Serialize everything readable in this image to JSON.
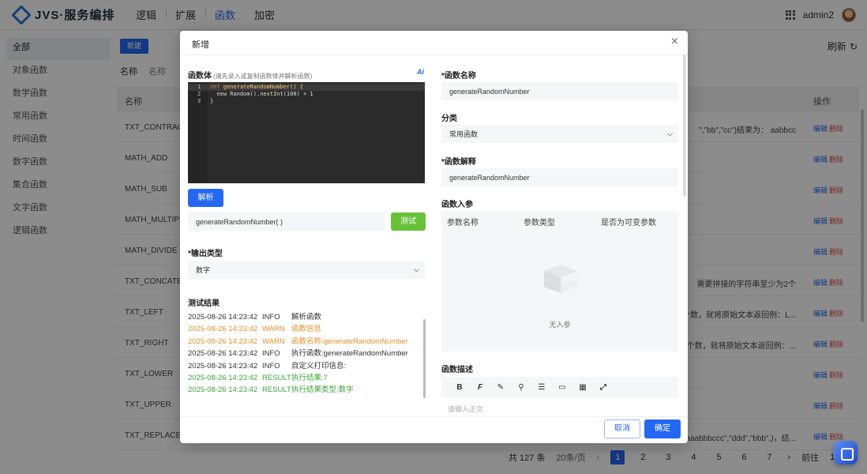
{
  "app": {
    "logo_text": "JVS·服务编排",
    "nav": [
      "逻辑",
      "扩展",
      "函数",
      "加密"
    ],
    "nav_active": "函数",
    "user": "admin2"
  },
  "sidebar": {
    "items": [
      "全部",
      "对象函数",
      "数学函数",
      "常用函数",
      "时间函数",
      "数字函数",
      "集合函数",
      "文字函数",
      "逻辑函数"
    ],
    "active": "全部"
  },
  "main": {
    "new_button": "新建",
    "refresh": "刷新",
    "filter_label": "名称",
    "filter_placeholder": "名称",
    "col_name": "名称",
    "col_action": "操作",
    "rows": [
      {
        "name": "TXT_CONTRACT",
        "desc": "\",\"bb\",\"cc\")结果为： aabbcc"
      },
      {
        "name": "MATH_ADD",
        "desc": ""
      },
      {
        "name": "MATH_SUB",
        "desc": ""
      },
      {
        "name": "MATH_MULTIPLY",
        "desc": ""
      },
      {
        "name": "MATH_DIVIDE",
        "desc": ""
      },
      {
        "name": "TXT_CONCATEN",
        "desc": "需要拼接的字符串至少为2个"
      },
      {
        "name": "TXT_LEFT",
        "desc": "符个数，就将原始文本返回例：L..."
      },
      {
        "name": "TXT_RIGHT",
        "desc": "字符个数，就将原始文本返回例：..."
      },
      {
        "name": "TXT_LOWER",
        "desc": ""
      },
      {
        "name": "TXT_UPPER",
        "desc": ""
      },
      {
        "name": "TXT_REPLACE",
        "desc": "E(\"aaabbbccc\",\"ddd\",\"bbb\",)，结..."
      }
    ],
    "edit": "编辑",
    "delete": "删除",
    "pager": {
      "total": "共 127 条",
      "size": "20条/页",
      "pages": [
        "1",
        "2",
        "3",
        "4",
        "5",
        "6",
        "7"
      ],
      "current": "1",
      "goto": "前往",
      "goto_value": "1"
    }
  },
  "modal": {
    "title": "新增",
    "close": "×",
    "body_label": "函数体",
    "body_hint": "(请先录入或复制函数体并解析函数)",
    "ai_icon": "Ai",
    "code_lines": [
      {
        "no": "1",
        "text": "def generateRandomNumber() {"
      },
      {
        "no": "2",
        "text": "  new Random().nextInt(100) + 1"
      },
      {
        "no": "3",
        "text": "}"
      }
    ],
    "parse_button": "解析",
    "signature": "generateRandomNumber( )",
    "test_button": "测试",
    "output_type_label": "*输出类型",
    "output_type_value": "数字",
    "test_result_label": "测试结果",
    "logs": [
      {
        "ts": "2025-08-26 14:23:42",
        "level": "INFO",
        "msg": "解析函数",
        "kind": "info"
      },
      {
        "ts": "2025-08-26 14:23:42",
        "level": "WARN",
        "msg": "函数信息",
        "kind": "warn"
      },
      {
        "ts": "2025-08-26 14:23:42",
        "level": "WARN",
        "msg": "函数名称:generateRandomNumber",
        "kind": "warn"
      },
      {
        "ts": "2025-08-26 14:23:42",
        "level": "INFO",
        "msg": "执行函数:generateRandomNumber",
        "kind": "info"
      },
      {
        "ts": "2025-08-26 14:23:42",
        "level": "INFO",
        "msg": "自定义打印信息:",
        "kind": "info"
      },
      {
        "ts": "2025-08-26 14:23:42",
        "level": "RESULT",
        "msg": "执行结果:7",
        "kind": "result"
      },
      {
        "ts": "2025-08-26 14:23:42",
        "level": "RESULT",
        "msg": "执行结果类型:数字",
        "kind": "result"
      }
    ],
    "name_label": "*函数名称",
    "name_value": "generateRandomNumber",
    "category_label": "分类",
    "category_value": "常用函数",
    "explain_label": "*函数解释",
    "explain_value": "generateRandomNumber",
    "params_label": "函数入参",
    "param_cols": [
      "参数名称",
      "参数类型",
      "是否为可变参数"
    ],
    "params_empty": "无入参",
    "desc_label": "函数描述",
    "desc_placeholder": "请输入正文",
    "toolbar_icons": [
      "bold-icon",
      "font-icon",
      "brush-icon",
      "link-icon",
      "list-icon",
      "image-icon",
      "table-icon",
      "fullscreen-icon"
    ],
    "cancel": "取消",
    "confirm": "确定"
  }
}
